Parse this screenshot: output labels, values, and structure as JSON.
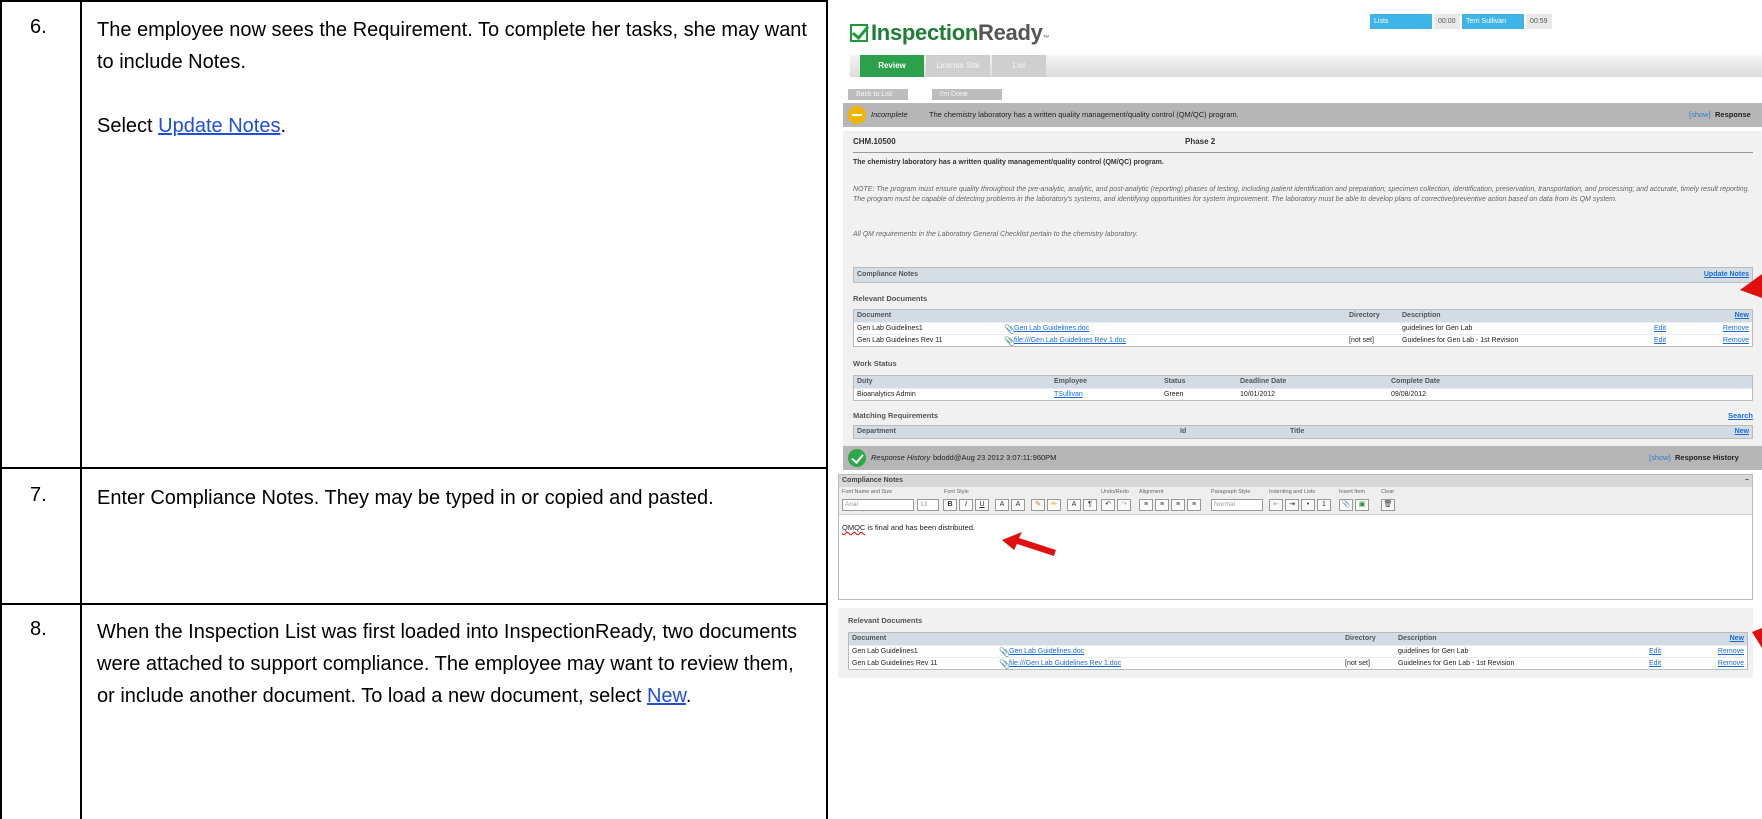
{
  "steps": [
    {
      "num": "6.",
      "para1": "The employee now sees the Requirement.  To complete her tasks, she may want to include Notes.",
      "pre": "Select ",
      "link": "Update Notes",
      "post": "."
    },
    {
      "num": "7.",
      "para1": "Enter Compliance Notes.  They may be typed in or copied and pasted."
    },
    {
      "num": "8.",
      "para1": "When the Inspection List was first loaded into InspectionReady, two documents were attached to support compliance.  The employee may want to review them, or include another document.  To load a new document, select ",
      "link": "New",
      "post": "."
    }
  ],
  "app": {
    "logo_brand": "Inspection",
    "logo_ready": "Ready",
    "logo_tm": "™",
    "topbar": {
      "lists": "Lists",
      "time1": "00:00",
      "user": "Terri Sullivan",
      "time2": "00:59"
    },
    "tabs": [
      "Review",
      "License Site",
      "List"
    ],
    "buttons": {
      "back": "Back to List",
      "done": "I'm Done"
    },
    "status_bar": {
      "status": "Incomplete",
      "text": "The chemistry laboratory has a written quality management/quality control (QM/QC) program.",
      "show": "[show]",
      "label": "Response"
    },
    "requirement": {
      "id": "CHM.10500",
      "phase": "Phase 2",
      "title": "The chemistry laboratory has a written quality management/quality control (QM/QC) program.",
      "note": "NOTE:  The program must ensure quality throughout the pre-analytic, analytic, and post-analytic (reporting) phases of testing, including patient identification and preparation; specimen collection, identification, preservation, transportation, and processing; and accurate, timely result reporting.  The program must be capable of detecting problems in the laboratory's systems, and identifying opportunities for system improvement.  The laboratory must be able to develop plans of corrective/preventive action based on data from its QM system.",
      "note2": "All QM requirements in the Laboratory General Checklist pertain to the chemistry laboratory."
    },
    "compliance": {
      "label": "Compliance Notes",
      "update": "Update Notes"
    },
    "relevant_docs": {
      "label": "Relevant Documents",
      "headers": {
        "document": "Document",
        "directory": "Directory",
        "description": "Description",
        "new": "New"
      },
      "rows": [
        {
          "document": "Gen Lab Guidelines1",
          "file": "Gen Lab Guidelines.doc",
          "directory": "",
          "description": "guidelines for Gen Lab",
          "edit": "Edit",
          "remove": "Remove"
        },
        {
          "document": "Gen Lab Guidelines Rev 11",
          "file": "file:///Gen Lab Guidelines Rev 1.doc",
          "directory": "[not set]",
          "description": "Guidelines for Gen Lab - 1st Revision",
          "edit": "Edit",
          "remove": "Remove"
        }
      ]
    },
    "work_status": {
      "label": "Work Status",
      "headers": {
        "duty": "Duty",
        "employee": "Employee",
        "status": "Status",
        "deadline": "Deadline Date",
        "complete": "Complete Date"
      },
      "row": {
        "duty": "Bioanalytics Admin",
        "employee": "TSullivan",
        "status": "Green",
        "deadline": "10/01/2012",
        "complete": "09/08/2012"
      }
    },
    "matching": {
      "label": "Matching Requirements",
      "search": "Search",
      "headers": {
        "department": "Department",
        "id": "Id",
        "title": "Title",
        "new": "New"
      }
    },
    "history_bar": {
      "label": "Response History",
      "text": "bdodd@Aug 23 2012 3:07:11:960PM",
      "show": "[show]",
      "title": "Response History"
    }
  },
  "editor": {
    "title": "Compliance Notes",
    "collapse": "−",
    "labels": {
      "font": "Font Name and Size",
      "style": "Font Style",
      "undo": "Undo/Redo",
      "align": "Alignment",
      "para": "Paragraph Style",
      "indent": "Indenting and Lists",
      "insert": "Insert Item",
      "clear": "Clear"
    },
    "font_name": "Arial",
    "font_size": "13",
    "para_style": "Normal",
    "text_misspelled": "QMQC",
    "text_rest": " is final and has been distributed."
  },
  "docs_shot": {
    "label": "Relevant Documents",
    "headers": {
      "document": "Document",
      "directory": "Directory",
      "description": "Description",
      "new": "New"
    },
    "rows": [
      {
        "document": "Gen Lab Guidelines1",
        "file": "Gen Lab Guidelines.doc",
        "directory": "",
        "description": "guidelines for Gen Lab",
        "edit": "Edit",
        "remove": "Remove"
      },
      {
        "document": "Gen Lab Guidelines Rev 11",
        "file": "file:///Gen Lab Guidelines Rev 1.doc",
        "directory": "[not set]",
        "description": "Guidelines for Gen Lab - 1st Revision",
        "edit": "Edit",
        "remove": "Remove"
      }
    ]
  },
  "colors": {
    "accent_green": "#2aa14a",
    "topbar_blue": "#3fb4e8",
    "link_blue": "#1a6bd6",
    "arrow_red": "#e01010"
  }
}
